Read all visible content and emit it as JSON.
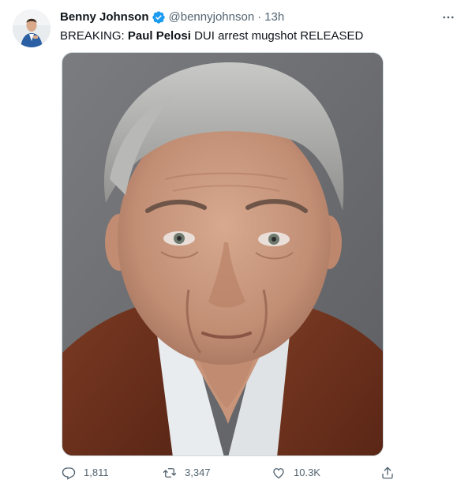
{
  "tweet": {
    "author_name": "Benny Johnson",
    "handle": "@bennyjohnson",
    "separator": "·",
    "time": "13h",
    "text_prefix": "BREAKING: ",
    "text_bold": "Paul Pelosi",
    "text_suffix": " DUI arrest mugshot RELEASED",
    "verified": true
  },
  "icons": {
    "verified": "verified-badge-icon",
    "more": "more-horizontal-icon",
    "reply": "reply-icon",
    "retweet": "retweet-icon",
    "like": "heart-icon",
    "share": "share-icon"
  },
  "actions": {
    "reply_count": "1,811",
    "retweet_count": "3,347",
    "like_count": "10.3K"
  },
  "colors": {
    "verified_blue": "#1d9bf0",
    "text_primary": "#0f1419",
    "text_secondary": "#536471"
  }
}
